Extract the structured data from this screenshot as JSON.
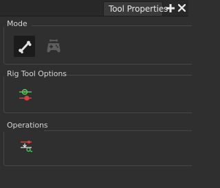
{
  "tab": {
    "title": "Tool Properties"
  },
  "sections": {
    "mode": {
      "title": "Mode"
    },
    "rig_tool_options": {
      "title": "Rig Tool Options"
    },
    "operations": {
      "title": "Operations"
    }
  },
  "icons": {
    "mode_bone": "bone-tool-icon",
    "mode_game": "gamepad-icon",
    "rig_option": "rig-bone-manipulator-icon",
    "operation": "reset-rig-pose-icon"
  },
  "colors": {
    "accent_green": "#5cc45c",
    "accent_red": "#d94040",
    "selected_bg": "#1b1b1b"
  }
}
